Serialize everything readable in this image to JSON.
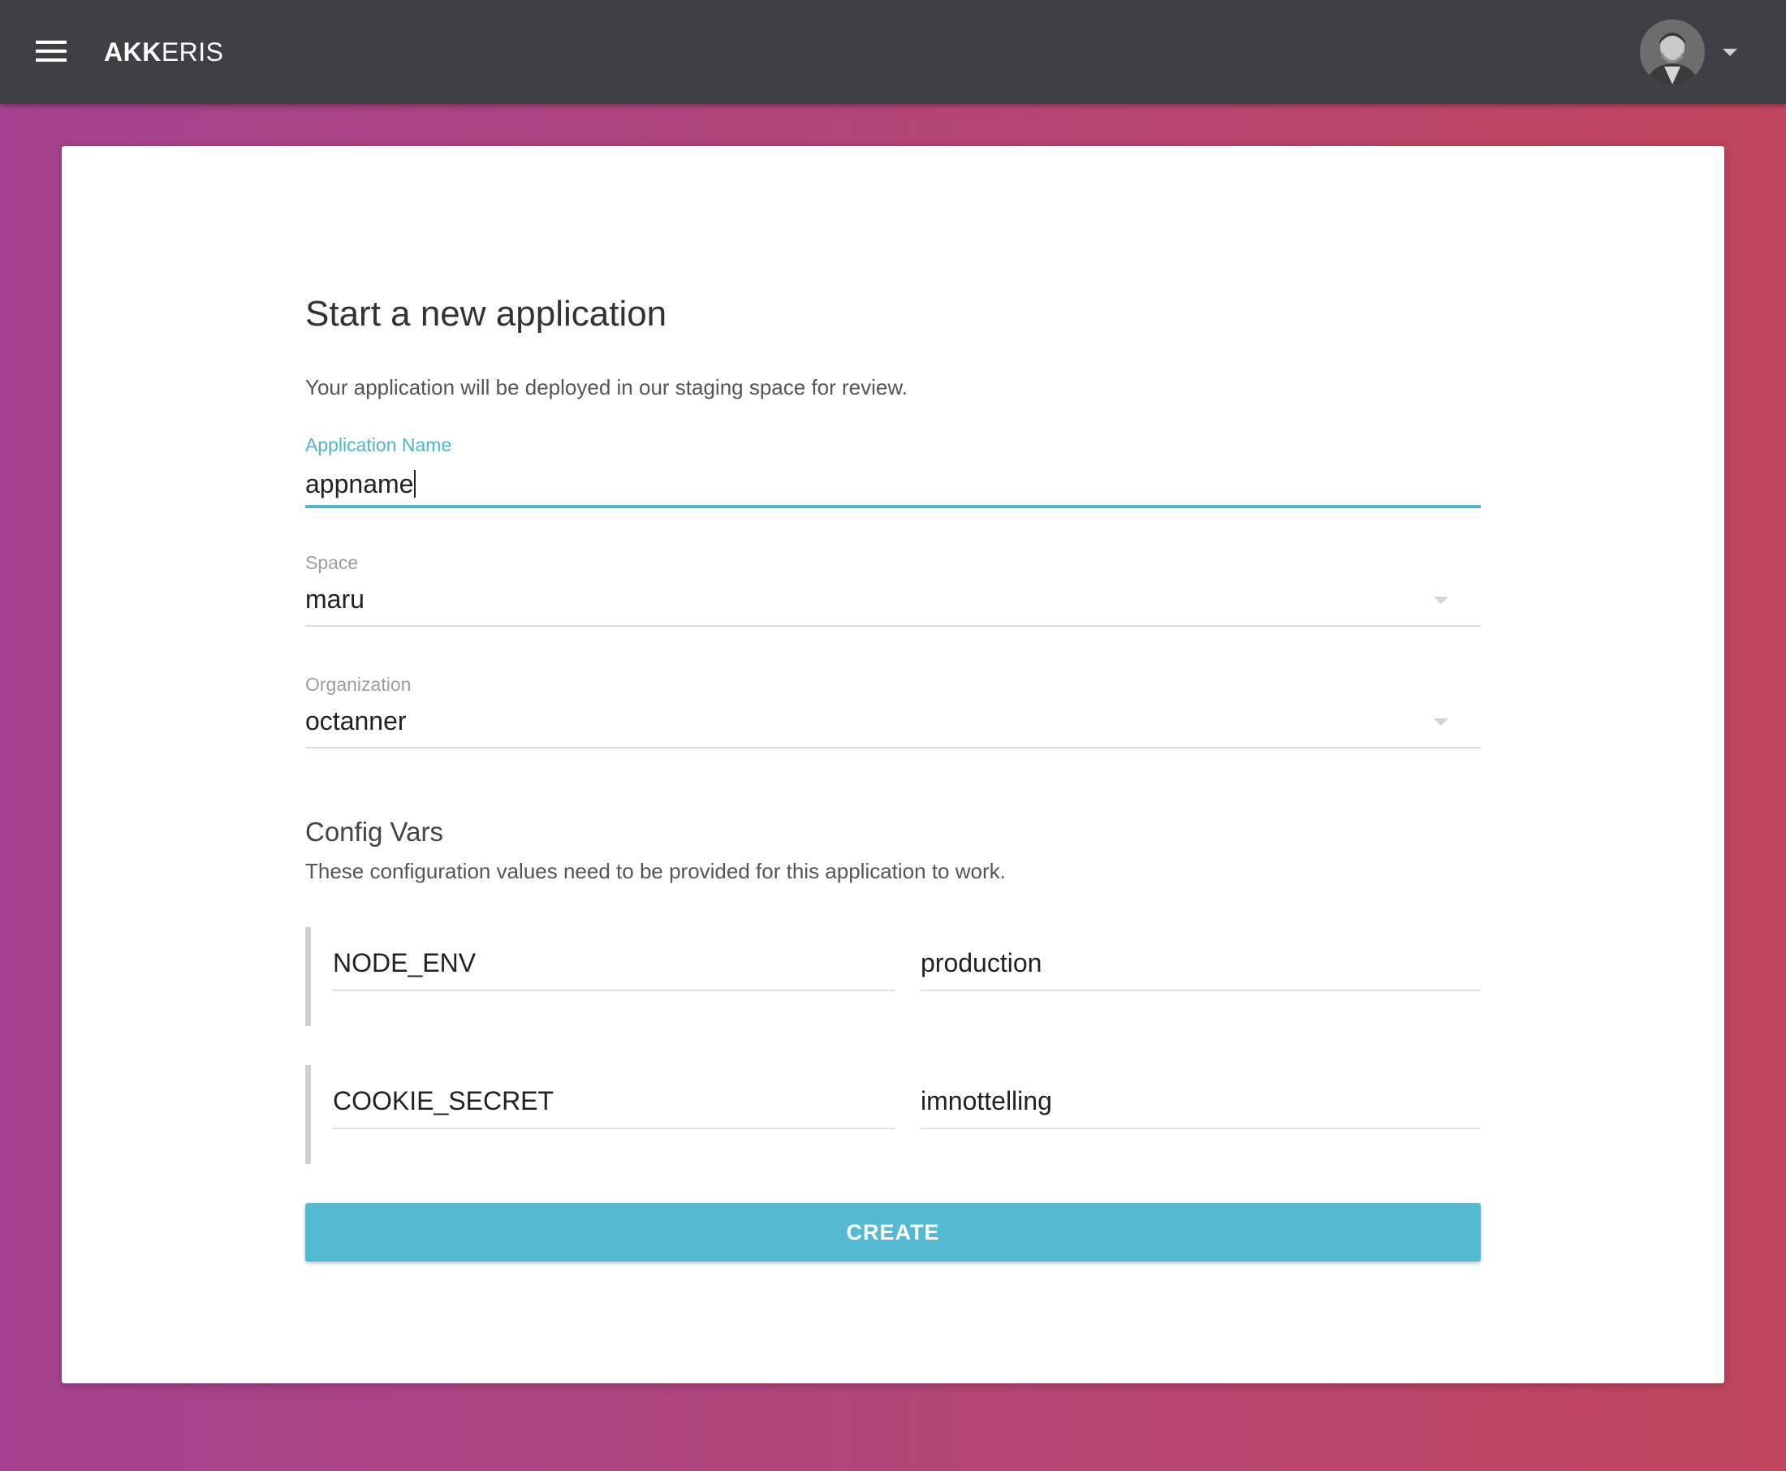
{
  "header": {
    "brand_bold": "AKK",
    "brand_light": "ERIS",
    "menu_icon": "hamburger-menu-icon",
    "avatar_icon": "user-avatar",
    "account_caret_icon": "caret-down-icon"
  },
  "form": {
    "title": "Start a new application",
    "subtitle": "Your application will be deployed in our staging space for review.",
    "app_name": {
      "label": "Application Name",
      "value": "appname"
    },
    "space": {
      "label": "Space",
      "value": "maru"
    },
    "organization": {
      "label": "Organization",
      "value": "octanner"
    },
    "config": {
      "title": "Config Vars",
      "description": "These configuration values need to be provided for this application to work.",
      "vars": [
        {
          "key": "NODE_ENV",
          "value": "production"
        },
        {
          "key": "COOKIE_SECRET",
          "value": "imnottelling"
        }
      ]
    },
    "create_label": "CREATE"
  },
  "colors": {
    "accent": "#4fb6cd",
    "button": "#53bad2",
    "topbar": "#3d4045",
    "gradient_left": "#a4428f",
    "gradient_right": "#c1455d"
  }
}
